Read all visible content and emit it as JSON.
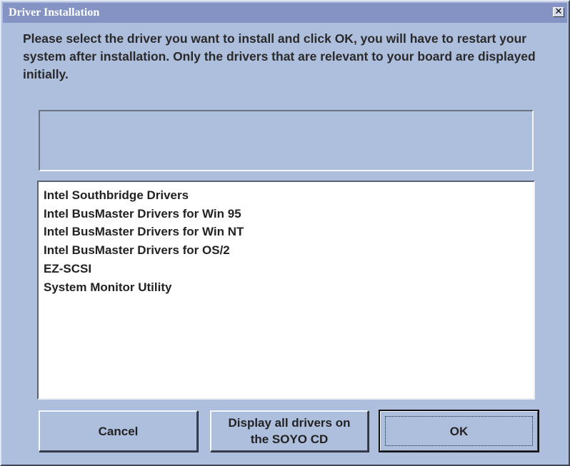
{
  "window": {
    "title": "Driver Installation",
    "close_icon": "close-icon",
    "close_glyph": "✕"
  },
  "instructions": "Please select the driver you want to install and click OK, you will have to restart your system after installation. Only the drivers that are relevant to your board are displayed initially.",
  "info_box": {
    "text": ""
  },
  "driver_list": {
    "items": [
      "Intel Southbridge Drivers",
      "Intel BusMaster Drivers for Win 95",
      "Intel BusMaster Drivers for Win NT",
      "Intel BusMaster Drivers for OS/2",
      "EZ-SCSI",
      "System Monitor Utility"
    ]
  },
  "buttons": {
    "cancel_label": "Cancel",
    "display_all_label": "Display all drivers on the SOYO CD",
    "ok_label": "OK"
  },
  "colors": {
    "dialog_background": "#aebedd",
    "titlebar": "#8493c3",
    "list_background": "#ffffff"
  }
}
